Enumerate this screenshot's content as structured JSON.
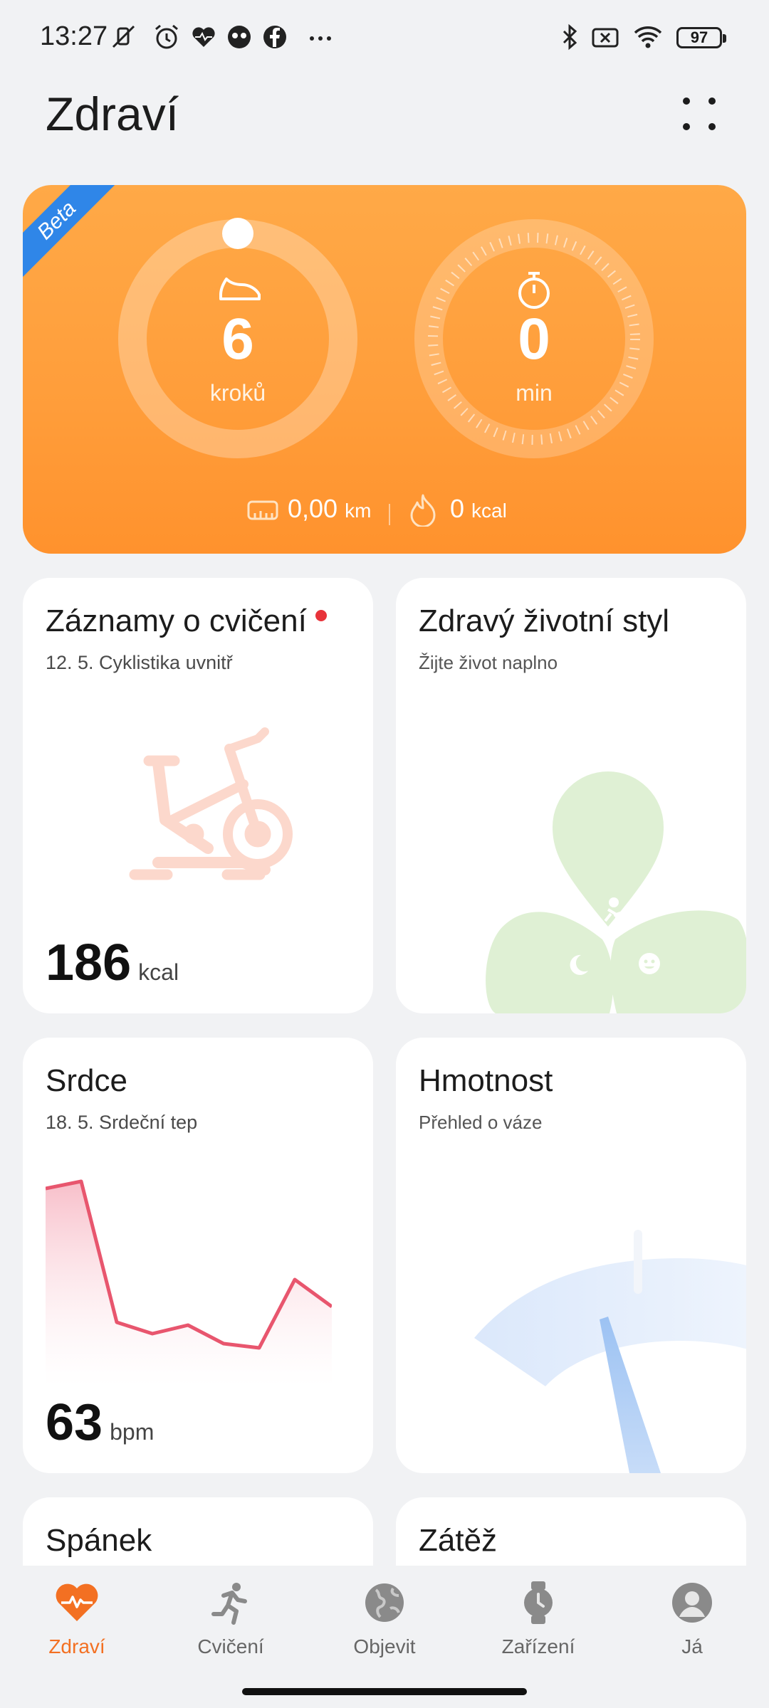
{
  "status_bar": {
    "time": "13:27",
    "battery": "97",
    "icons": [
      "mute-vibrate-icon",
      "alarm-icon",
      "health-icon",
      "app-icon",
      "facebook-icon",
      "more-dots-icon",
      "bluetooth-icon",
      "no-sim-icon",
      "wifi-icon"
    ]
  },
  "header": {
    "title": "Zdraví",
    "more_icon": "dots-grid-icon"
  },
  "summary": {
    "badge": "Beta",
    "steps": {
      "value": "6",
      "unit": "kroků",
      "icon": "shoe-icon"
    },
    "active_minutes": {
      "value": "0",
      "unit": "min",
      "icon": "stopwatch-icon"
    },
    "distance": {
      "value": "0,00",
      "unit": "km",
      "icon": "ruler-icon"
    },
    "calories": {
      "value": "0",
      "unit": "kcal",
      "icon": "flame-icon"
    },
    "accent": "#ff9d3a"
  },
  "tiles": {
    "exercise": {
      "title": "Záznamy o cvičení",
      "subtitle": "12. 5.  Cyklistika uvnitř",
      "value": "186",
      "unit": "kcal",
      "icon": "exercise-bike-icon"
    },
    "lifestyle": {
      "title": "Zdravý životní styl",
      "subtitle": "Žijte život naplno"
    },
    "heart": {
      "title": "Srdce",
      "subtitle": "18. 5.  Srdeční tep",
      "value": "63",
      "unit": "bpm",
      "accent": "#e8566e"
    },
    "weight": {
      "title": "Hmotnost",
      "subtitle": "Přehled o váze"
    },
    "sleep": {
      "title": "Spánek"
    },
    "stress": {
      "title": "Zátěž"
    }
  },
  "bottom_nav": {
    "items": [
      {
        "label": "Zdraví",
        "icon": "heart-pulse-icon",
        "active": true
      },
      {
        "label": "Cvičení",
        "icon": "running-icon",
        "active": false
      },
      {
        "label": "Objevit",
        "icon": "globe-icon",
        "active": false
      },
      {
        "label": "Zařízení",
        "icon": "watch-icon",
        "active": false
      },
      {
        "label": "Já",
        "icon": "profile-icon",
        "active": false
      }
    ],
    "active_color": "#f37022"
  }
}
